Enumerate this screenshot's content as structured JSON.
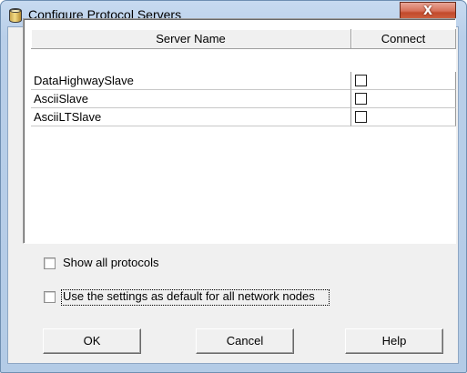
{
  "window": {
    "title": "Configure Protocol Servers",
    "close_label": "X",
    "icon": "database-icon"
  },
  "table": {
    "columns": [
      "Server Name",
      "Connect"
    ],
    "rows": [
      {
        "name": "DataHighwaySlave",
        "connect": false
      },
      {
        "name": "AsciiSlave",
        "connect": false
      },
      {
        "name": "AsciiLTSlave",
        "connect": false
      }
    ]
  },
  "options": {
    "show_all": {
      "label": "Show all protocols",
      "checked": false
    },
    "use_default": {
      "label": "Use the settings as default for all network nodes",
      "checked": false
    }
  },
  "buttons": {
    "ok": "OK",
    "cancel": "Cancel",
    "help": "Help"
  }
}
